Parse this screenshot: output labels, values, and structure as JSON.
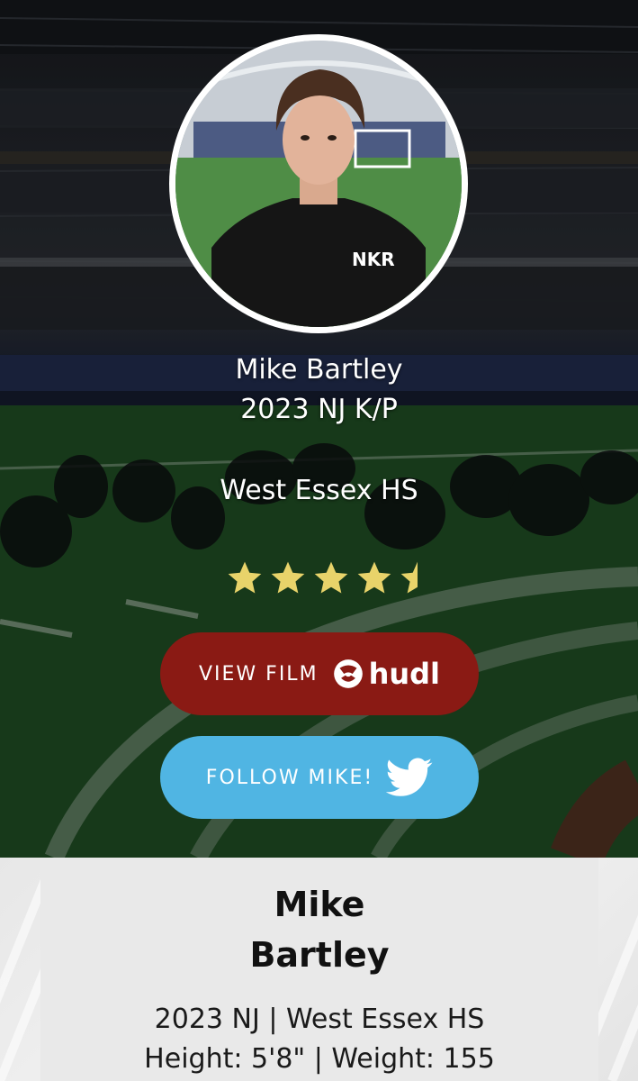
{
  "hero": {
    "name": "Mike Bartley",
    "class_line": "2023 NJ K/P",
    "school": "West Essex HS",
    "rating_stars": 4.5,
    "rating_max": 5
  },
  "buttons": {
    "film_label": "VIEW FILM",
    "film_brand": "hudl",
    "follow_label": "FOLLOW MIKE!"
  },
  "card": {
    "first_name": "Mike",
    "last_name": "Bartley",
    "meta_line_1": "2023 NJ | West Essex HS",
    "meta_line_2": "Height: 5'8\" | Weight: 155"
  },
  "colors": {
    "film_button": "#8a1a14",
    "follow_button": "#50b5e3",
    "star": "#e8d36a"
  },
  "icons": {
    "film_icon": "hudl-logo-icon",
    "follow_icon": "twitter-bird-icon"
  }
}
